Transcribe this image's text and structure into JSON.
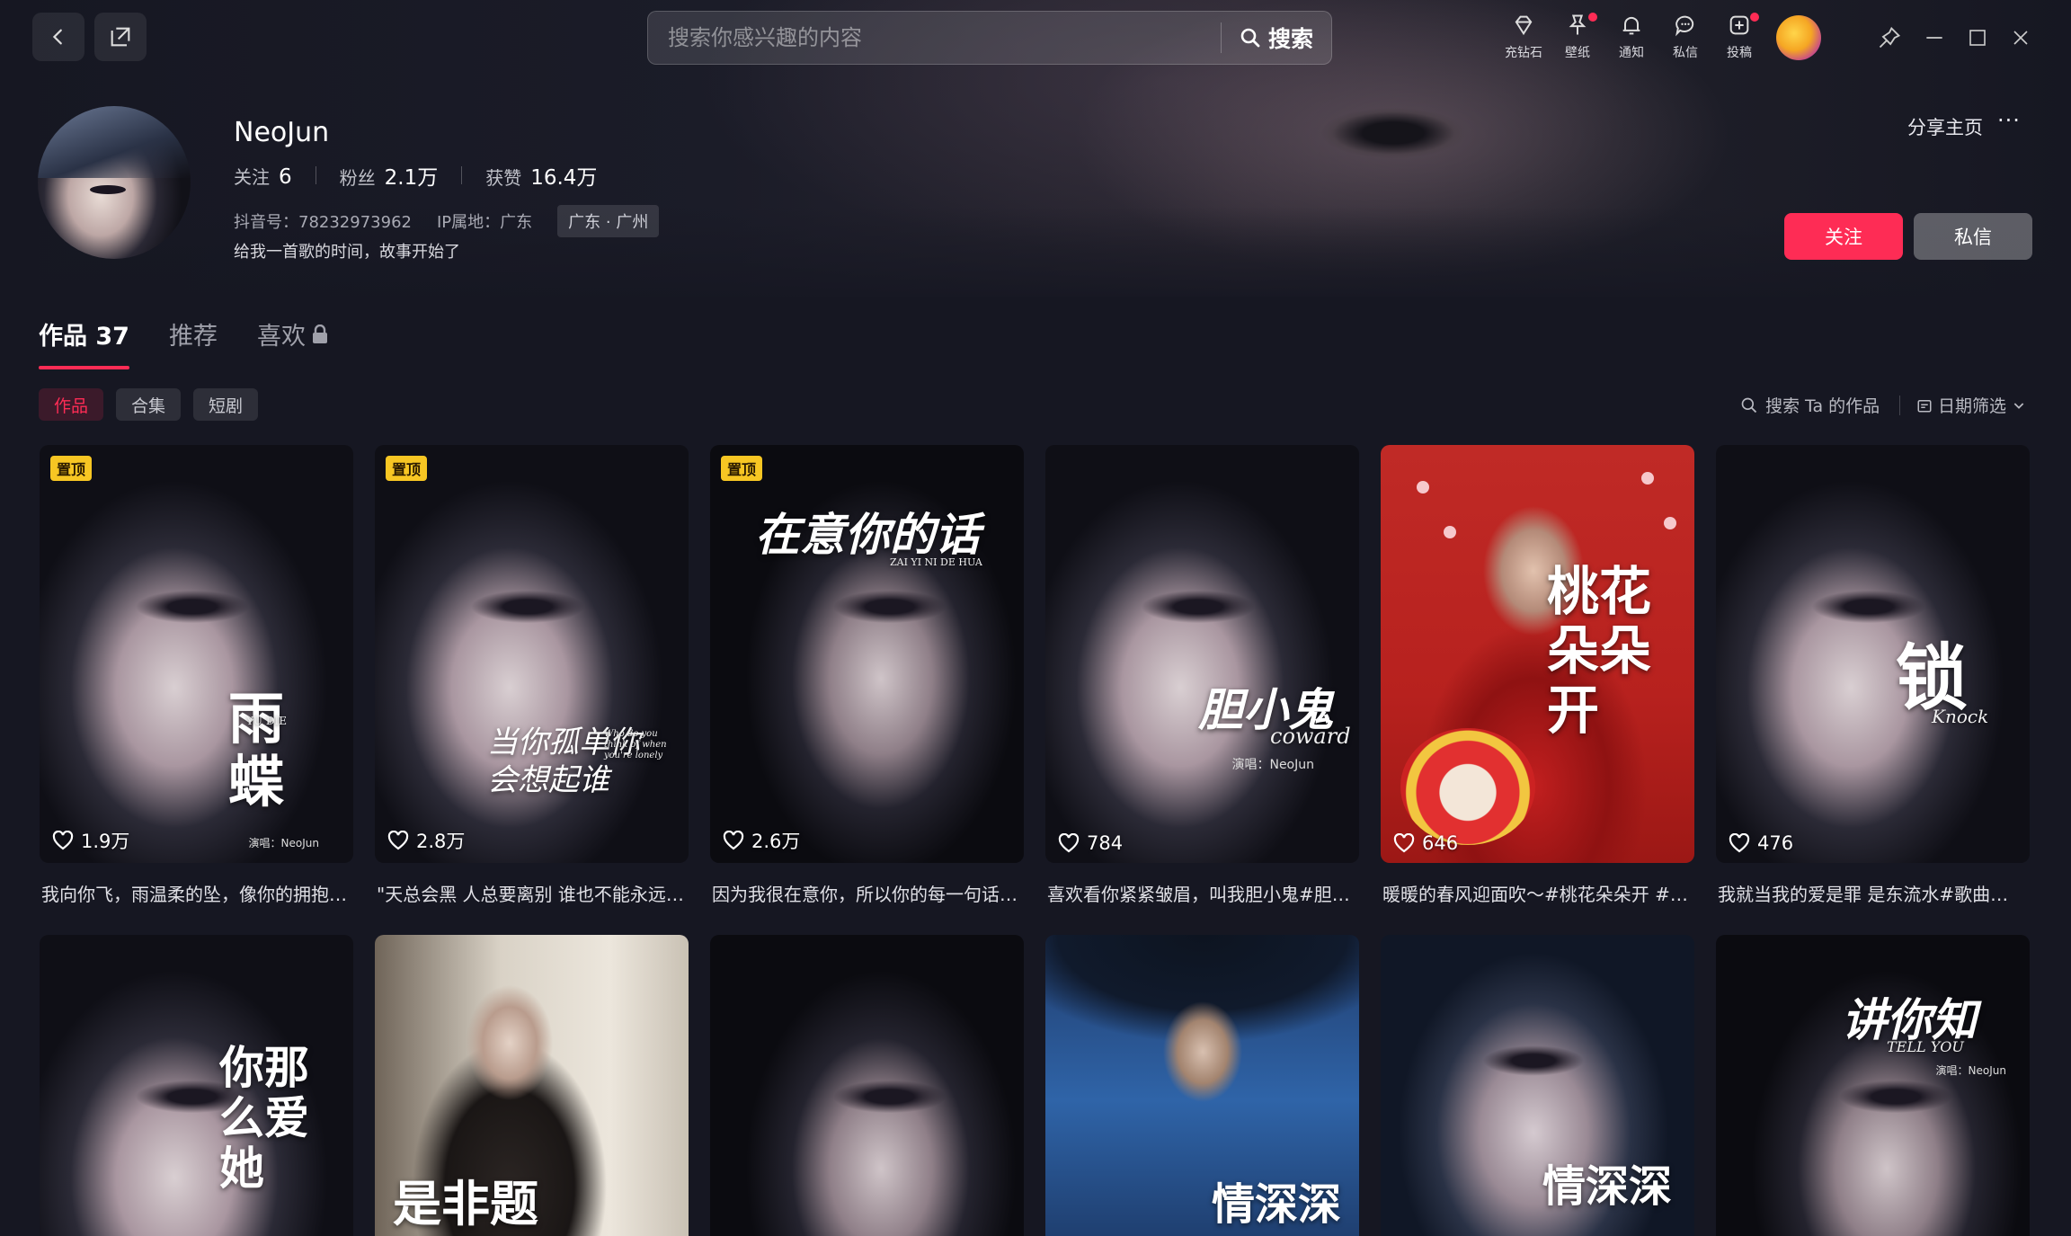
{
  "topbar": {
    "search_placeholder": "搜索你感兴趣的内容",
    "search_button": "搜索",
    "tools": [
      {
        "icon": "diamond-icon",
        "label": "充钻石",
        "dot": false
      },
      {
        "icon": "wallpaper-icon",
        "label": "壁纸",
        "dot": true
      },
      {
        "icon": "bell-icon",
        "label": "通知",
        "dot": false
      },
      {
        "icon": "chat-icon",
        "label": "私信",
        "dot": false
      },
      {
        "icon": "upload-icon",
        "label": "投稿",
        "dot": true
      }
    ]
  },
  "profile": {
    "name": "NeoJun",
    "following_label": "关注",
    "following": "6",
    "followers_label": "粉丝",
    "followers": "2.1万",
    "likes_label": "获赞",
    "likes": "16.4万",
    "douyin_id": "抖音号：78232973962",
    "ip": "IP属地：广东",
    "location_tag": "广东 · 广州",
    "bio": "给我一首歌的时间，故事开始了",
    "share_label": "分享主页",
    "more_label": "···",
    "follow_button": "关注",
    "message_button": "私信"
  },
  "tabs": [
    {
      "label": "作品 37",
      "active": true
    },
    {
      "label": "推荐",
      "active": false
    },
    {
      "label": "喜欢",
      "active": false,
      "locked": true
    }
  ],
  "chips": [
    {
      "label": "作品",
      "active": true
    },
    {
      "label": "合集",
      "active": false
    },
    {
      "label": "短剧",
      "active": false
    }
  ],
  "filters": {
    "search_works": "搜索 Ta 的作品",
    "date_filter": "日期筛选"
  },
  "pin_label": "置顶",
  "videos": [
    {
      "caption": "我向你飞，雨温柔的坠，像你的拥抱…",
      "likes": "1.9万",
      "pinned": true,
      "art": "雨蝶",
      "sub": "YU DIE",
      "credit": "演唱：NeoJun"
    },
    {
      "caption": "\"天总会黑 人总要离别 谁也不能永远…",
      "likes": "2.8万",
      "pinned": true,
      "art": "当你孤单你会想起谁",
      "sub": "Who do you think of when you're lonely"
    },
    {
      "caption": "因为我很在意你，所以你的每一句话…",
      "likes": "2.6万",
      "pinned": true,
      "art": "在意你的话",
      "sub": "ZAI YI NI DE HUA"
    },
    {
      "caption": "喜欢看你紧紧皱眉，叫我胆小鬼#胆小…",
      "likes": "784",
      "pinned": false,
      "art": "胆小鬼",
      "sub": "coward",
      "credit": "演唱：NeoJun"
    },
    {
      "caption": "暖暖的春风迎面吹～#桃花朵朵开 #…",
      "likes": "646",
      "pinned": false,
      "art": "桃花朵朵开"
    },
    {
      "caption": "我就当我的爱是罪 是东流水#歌曲…",
      "likes": "476",
      "pinned": false,
      "art": "锁",
      "sub": "Knock"
    },
    {
      "art": "你那么爱她"
    },
    {
      "art": "是非题"
    },
    {
      "art": ""
    },
    {
      "art": "情深深"
    },
    {
      "art": "情深深"
    },
    {
      "art": "讲你知",
      "sub": "TELL YOU",
      "credit": "演唱：NeoJun"
    }
  ]
}
